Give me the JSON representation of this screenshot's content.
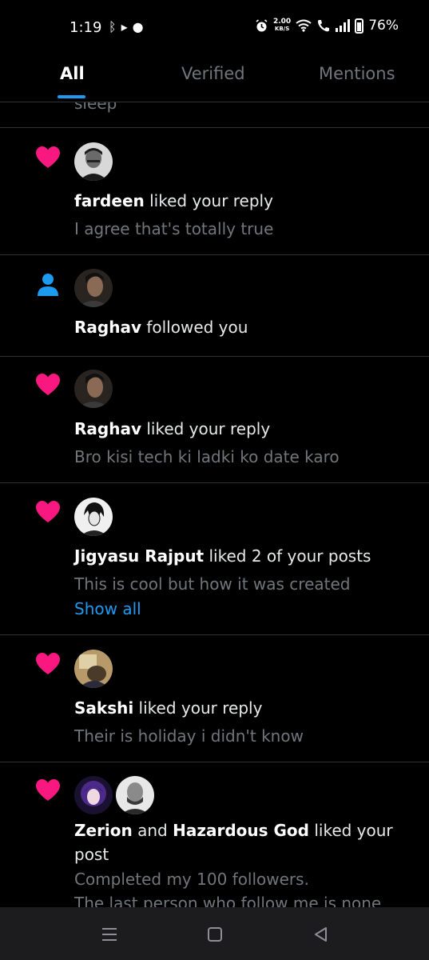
{
  "status_bar": {
    "time": "1:19",
    "left_icons": [
      "bluetooth-arrow-icon",
      "chat-bubble-icon"
    ],
    "speed_value": "2.00",
    "speed_unit": "KB/S",
    "battery": "76%",
    "right_icons": [
      "alarm-icon",
      "wifi-icon",
      "wifi-calling-icon",
      "signal-icon",
      "battery-icon"
    ]
  },
  "tabs": [
    {
      "label": "All",
      "active": true
    },
    {
      "label": "Verified",
      "active": false
    },
    {
      "label": "Mentions",
      "active": false
    }
  ],
  "feed": {
    "cut_text": "sleep",
    "notifications": [
      {
        "kind": "like",
        "user": "fardeen",
        "action": " liked your reply",
        "preview": "I agree that's totally true"
      },
      {
        "kind": "follow",
        "user": "Raghav",
        "action": " followed you"
      },
      {
        "kind": "like",
        "user": "Raghav",
        "action": " liked your reply",
        "preview": "Bro kisi tech ki ladki ko date karo"
      },
      {
        "kind": "like",
        "user": "Jigyasu Rajput",
        "action": " liked 2 of your posts",
        "preview": "This is cool but how it was created",
        "link": "Show all"
      },
      {
        "kind": "like",
        "user": "Sakshi",
        "action": " liked your reply",
        "preview": "Their is holiday i didn't know"
      },
      {
        "kind": "like",
        "user": "Zerion",
        "conjunction": " and ",
        "user2": "Hazardous God",
        "action": " liked your post",
        "preview_line1": "Completed my 100 followers.",
        "preview_line2": "The last person who follow me is none"
      }
    ]
  },
  "colors": {
    "background": "#000000",
    "like": "#f91880",
    "follow": "#1d9bf0",
    "link": "#1d9bf0",
    "muted": "#71767b",
    "divider": "#2f3336"
  },
  "nav_bar": {
    "buttons": [
      "menu-icon",
      "home-square-icon",
      "back-triangle-icon"
    ]
  }
}
